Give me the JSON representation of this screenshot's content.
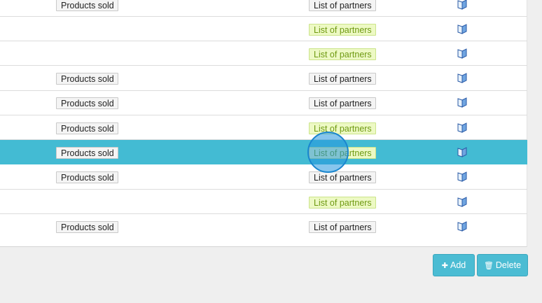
{
  "rows": [
    {
      "products": "Products sold",
      "partners": "List of partners",
      "partners_style": "plain"
    },
    {
      "products": "",
      "partners": "List of partners",
      "partners_style": "green"
    },
    {
      "products": "",
      "partners": "List of partners",
      "partners_style": "green"
    },
    {
      "products": "Products sold",
      "partners": "List of partners",
      "partners_style": "plain"
    },
    {
      "products": "Products sold",
      "partners": "List of partners",
      "partners_style": "plain"
    },
    {
      "products": "Products sold",
      "partners": "List of partners",
      "partners_style": "green"
    },
    {
      "products": "Products sold",
      "partners": "List of partners",
      "partners_style": "green",
      "selected": true
    },
    {
      "products": "Products sold",
      "partners": "List of partners",
      "partners_style": "plain"
    },
    {
      "products": "",
      "partners": "List of partners",
      "partners_style": "green"
    },
    {
      "products": "Products sold",
      "partners": "List of partners",
      "partners_style": "plain"
    }
  ],
  "row_icon": "book-icon",
  "toolbar": {
    "add_label": "Add",
    "add_icon": "plus-icon",
    "delete_label": "Delete",
    "delete_icon": "trash-icon"
  },
  "colors": {
    "selected_row": "#43bbd3",
    "button": "#4bbcd3",
    "partners_green_bg": "#edf9c4",
    "partners_green_text": "#6f9a12"
  }
}
